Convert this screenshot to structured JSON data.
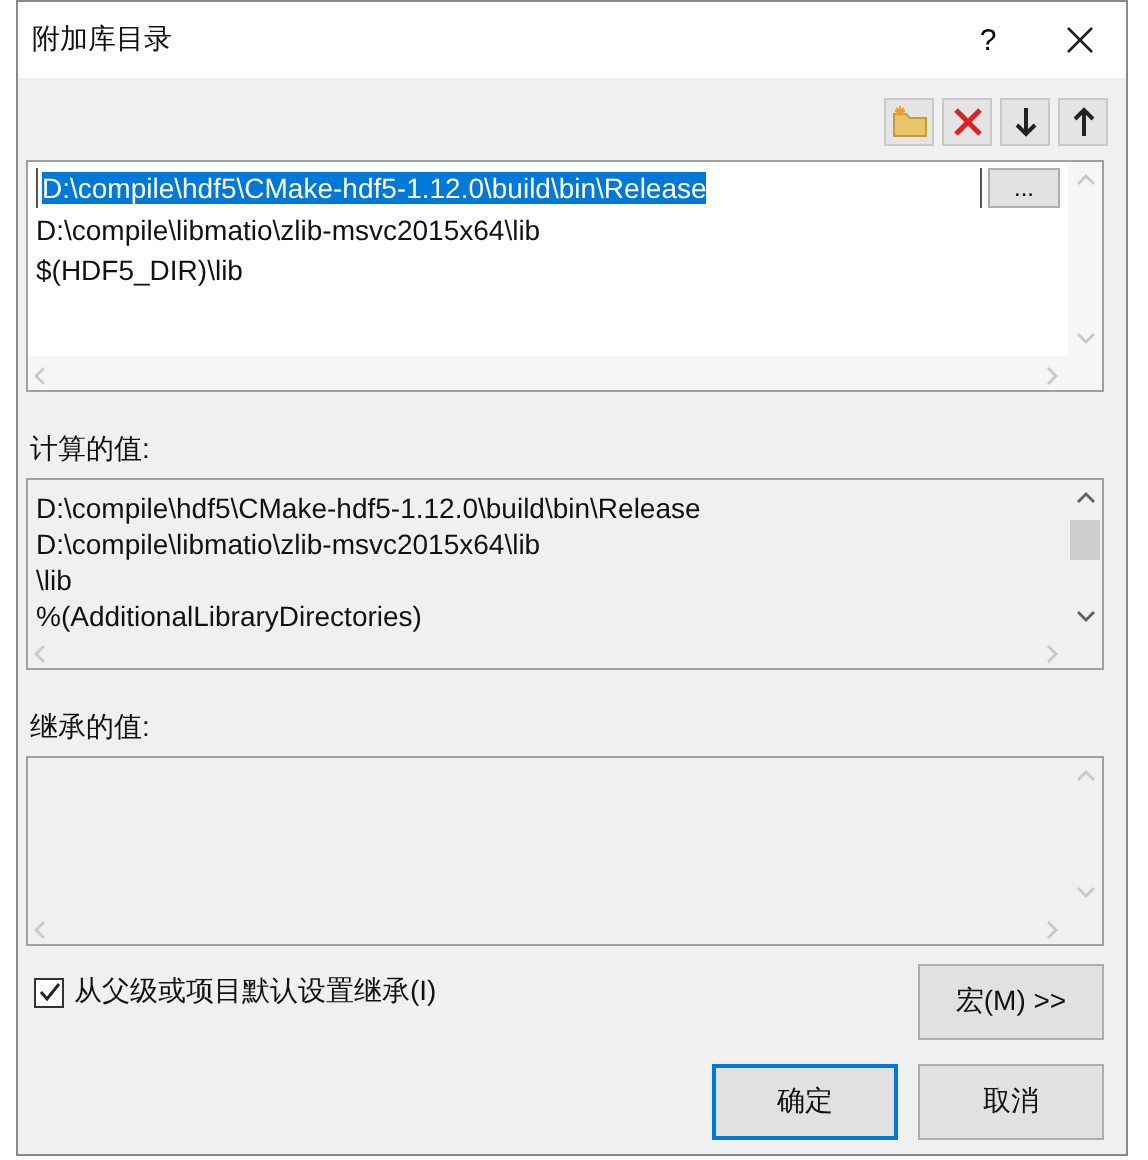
{
  "window": {
    "title": "附加库目录",
    "help": "?"
  },
  "directories": {
    "browse_button": "...",
    "items": [
      {
        "text": "D:\\compile\\hdf5\\CMake-hdf5-1.12.0\\build\\bin\\Release",
        "selected": true
      },
      {
        "text": "D:\\compile\\libmatio\\zlib-msvc2015x64\\lib",
        "selected": false
      },
      {
        "text": "$(HDF5_DIR)\\lib",
        "selected": false
      }
    ]
  },
  "computed": {
    "label": "计算的值:",
    "lines": [
      "D:\\compile\\hdf5\\CMake-hdf5-1.12.0\\build\\bin\\Release",
      "D:\\compile\\libmatio\\zlib-msvc2015x64\\lib",
      "\\lib",
      "%(AdditionalLibraryDirectories)"
    ]
  },
  "inherited": {
    "label": "继承的值:"
  },
  "inherit_checkbox": {
    "label": "从父级或项目默认设置继承(I)",
    "checked": true
  },
  "buttons": {
    "macros": "宏(M) >>",
    "ok": "确定",
    "cancel": "取消"
  }
}
